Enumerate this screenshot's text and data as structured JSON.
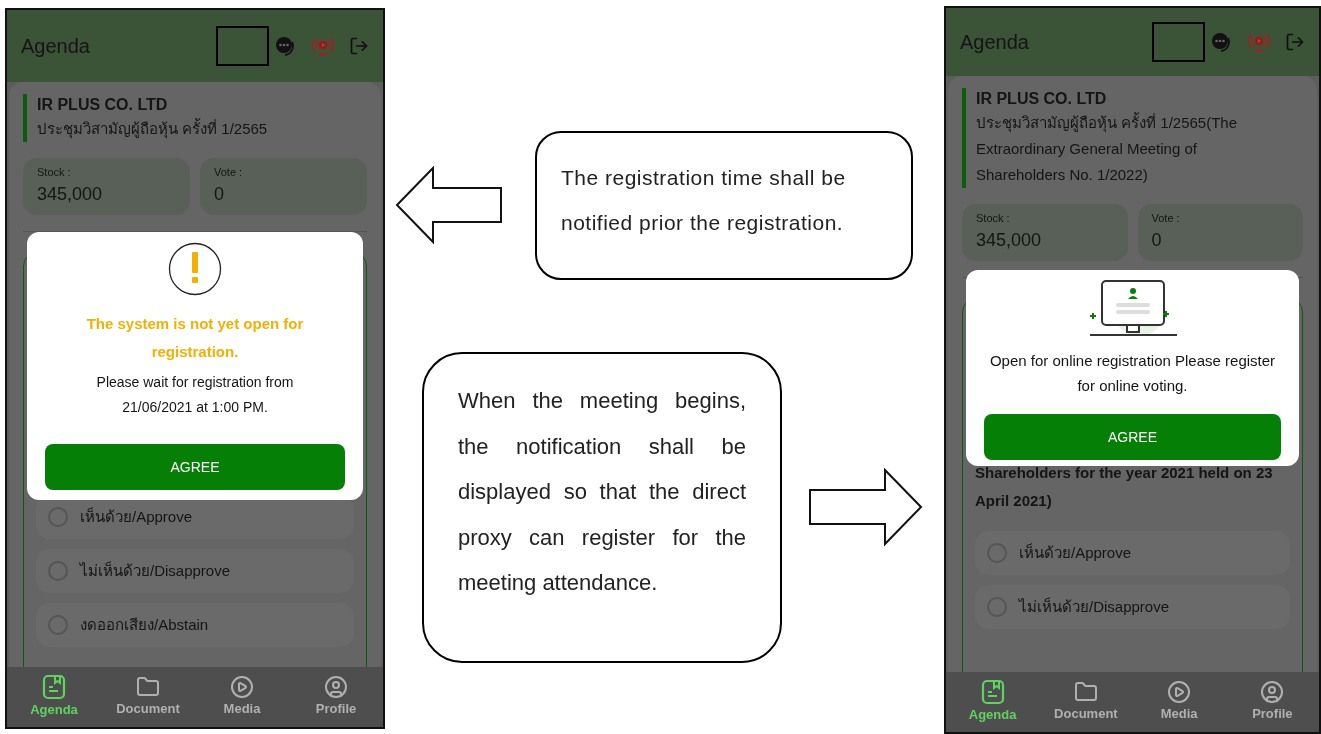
{
  "phones": [
    {
      "header": {
        "title": "Agenda"
      },
      "company": "IR PLUS CO. LTD",
      "meeting_title": "ประชุมวิสามัญผู้ถือหุ้น ครั้งที่ 1/2565",
      "stats": [
        {
          "label": "Stock :",
          "value": "345,000"
        },
        {
          "label": "Vote :",
          "value": "0"
        }
      ],
      "options": [
        {
          "label": "เห็นด้วย/Approve",
          "selected": false
        },
        {
          "label": "ไม่เห็นด้วย/Disapprove",
          "selected": false
        },
        {
          "label": "งดออกเสียง/Abstain",
          "selected": false
        }
      ],
      "dialog": {
        "kind": "warning",
        "title": "The system is not yet open for registration.",
        "message": "Please wait for registration from 21/06/2021 at 1:00 PM.",
        "button": "AGREE"
      },
      "nav": [
        {
          "label": "Agenda",
          "selected": true
        },
        {
          "label": "Document",
          "selected": false
        },
        {
          "label": "Media",
          "selected": false
        },
        {
          "label": "Profile",
          "selected": false
        }
      ]
    },
    {
      "header": {
        "title": "Agenda"
      },
      "company": "IR PLUS CO. LTD",
      "meeting_title": "ประชุมวิสามัญผู้ถือหุ้น ครั้งที่ 1/2565(The Extraordinary General Meeting of Shareholders No. 1/2022)",
      "stats": [
        {
          "label": "Stock :",
          "value": "345,000"
        },
        {
          "label": "Vote :",
          "value": "0"
        }
      ],
      "agenda_text": "Shareholders for the year 2021 held on 23 April 2021)",
      "options": [
        {
          "label": "เห็นด้วย/Approve",
          "selected": false
        },
        {
          "label": "ไม่เห็นด้วย/Disapprove",
          "selected": false
        }
      ],
      "dialog": {
        "kind": "register",
        "message": "Open for online registration Please register for online voting.",
        "button": "AGREE"
      },
      "nav": [
        {
          "label": "Agenda",
          "selected": true
        },
        {
          "label": "Document",
          "selected": false
        },
        {
          "label": "Media",
          "selected": false
        },
        {
          "label": "Profile",
          "selected": false
        }
      ]
    }
  ],
  "callouts": [
    {
      "text": "The registration time shall be notified prior the registration."
    },
    {
      "text": "When the meeting begins, the notification shall be displayed so that the direct proxy can register for the meeting attendance."
    }
  ]
}
